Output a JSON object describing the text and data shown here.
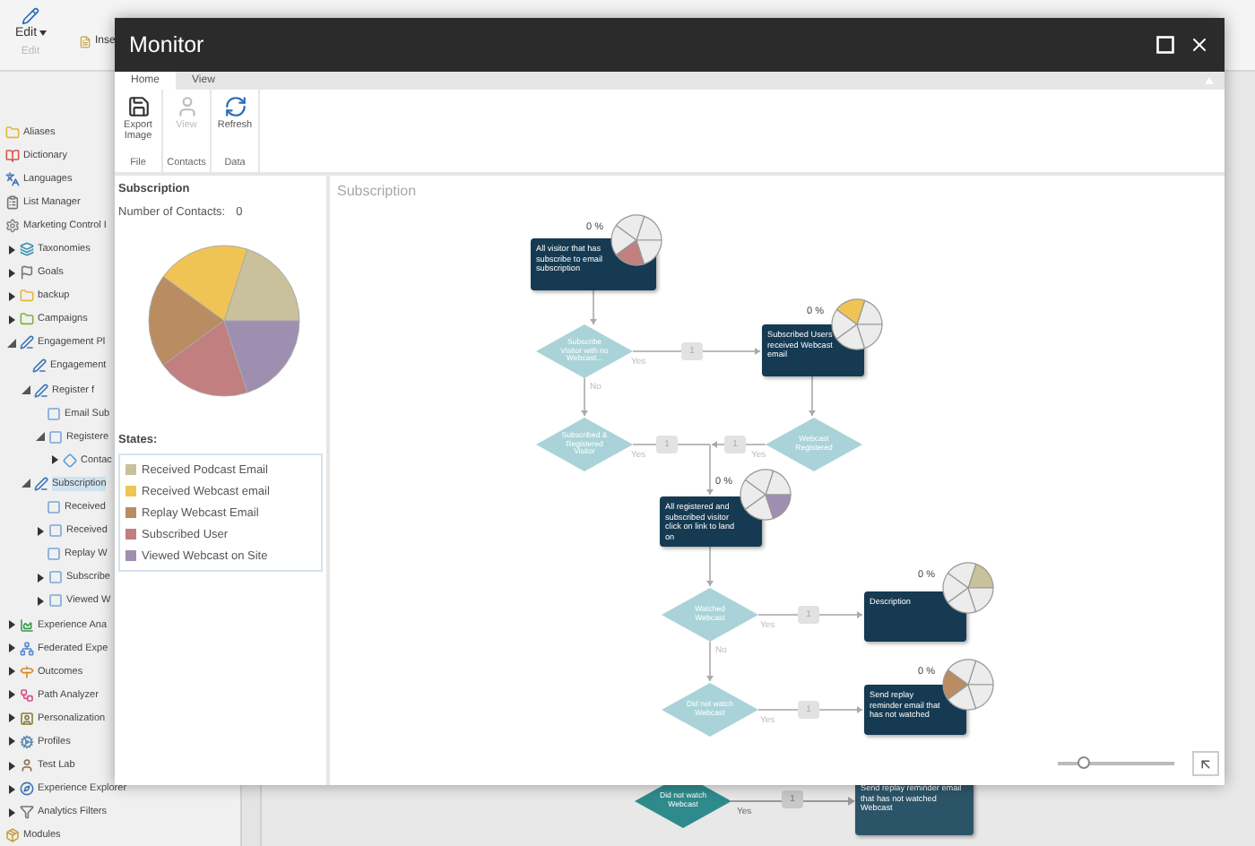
{
  "app_ribbon": {
    "edit_button": "Edit",
    "group_label": "Edit",
    "insert_item": "Inse"
  },
  "tree": [
    {
      "label": "Aliases",
      "selected": false
    },
    {
      "label": "Dictionary",
      "selected": false
    },
    {
      "label": "Languages",
      "selected": false
    },
    {
      "label": "List Manager",
      "selected": false
    },
    {
      "label": "Marketing Control I",
      "selected": false
    },
    {
      "label": "Taxonomies",
      "selected": false,
      "expanded": false
    },
    {
      "label": "Goals",
      "selected": false,
      "expanded": false
    },
    {
      "label": "backup",
      "selected": false,
      "expanded": false
    },
    {
      "label": "Campaigns",
      "selected": false,
      "expanded": false
    },
    {
      "label": "Engagement Pl",
      "selected": false,
      "expanded": true,
      "children": [
        {
          "label": "Engagement",
          "selected": false
        },
        {
          "label": "Register f",
          "selected": false,
          "expanded": true,
          "children": [
            {
              "label": "Email Sub",
              "selected": false
            },
            {
              "label": "Registere",
              "selected": false,
              "expanded": true,
              "children": [
                {
                  "label": "Contac",
                  "selected": false,
                  "expanded": false
                }
              ]
            }
          ]
        },
        {
          "label": "Subscription",
          "selected": true,
          "expanded": true,
          "children": [
            {
              "label": "Received",
              "selected": false
            },
            {
              "label": "Received",
              "selected": false,
              "expanded": false
            },
            {
              "label": "Replay W",
              "selected": false
            },
            {
              "label": "Subscribe",
              "selected": false,
              "expanded": false
            },
            {
              "label": "Viewed W",
              "selected": false,
              "expanded": false
            }
          ]
        }
      ]
    },
    {
      "label": "Experience Ana",
      "selected": false,
      "expanded": false
    },
    {
      "label": "Federated Expe",
      "selected": false,
      "expanded": false
    },
    {
      "label": "Outcomes",
      "selected": false,
      "expanded": false
    },
    {
      "label": "Path Analyzer",
      "selected": false,
      "expanded": false
    },
    {
      "label": "Personalization",
      "selected": false,
      "expanded": false
    },
    {
      "label": "Profiles",
      "selected": false,
      "expanded": false
    },
    {
      "label": "Test Lab",
      "selected": false,
      "expanded": false
    },
    {
      "label": "Experience Explorer",
      "selected": false,
      "expanded": false
    },
    {
      "label": "Analytics Filters",
      "selected": false,
      "expanded": false
    },
    {
      "label": "Modules",
      "selected": false
    }
  ],
  "background_flow": {
    "decision": "Did not watch Webcast",
    "edge_label": "Yes",
    "badge": "1",
    "action": "Send replay reminder email that has not watched Webcast"
  },
  "monitor": {
    "title": "Monitor",
    "tabs": [
      {
        "label": "Home",
        "selected": true
      },
      {
        "label": "View",
        "selected": false
      }
    ],
    "groups": [
      {
        "label": "File",
        "buttons": [
          {
            "label": "Export Image",
            "disabled": false
          }
        ]
      },
      {
        "label": "Contacts",
        "buttons": [
          {
            "label": "View",
            "disabled": true
          }
        ]
      },
      {
        "label": "Data",
        "buttons": [
          {
            "label": "Refresh",
            "disabled": false
          }
        ]
      }
    ],
    "summary": {
      "title": "Subscription",
      "contacts_label": "Number of Contacts:",
      "contacts_value": "0",
      "states_label": "States:"
    },
    "states": [
      {
        "name": "Received Podcast Email",
        "color": "#c8c19b"
      },
      {
        "name": "Received Webcast email",
        "color": "#f0c454"
      },
      {
        "name": "Replay Webcast Email",
        "color": "#b98c62"
      },
      {
        "name": "Subscribed User",
        "color": "#c17f7f"
      },
      {
        "name": "Viewed Webcast on Site",
        "color": "#9e8fb0"
      }
    ],
    "flow": {
      "title": "Subscription",
      "nodes": [
        {
          "kind": "action",
          "text": "All visitor that has subscribe to email subscription",
          "percent": "0 %",
          "color": "#c17f7f"
        },
        {
          "kind": "decision",
          "text": "Subscribe Visitor with no Webcast..."
        },
        {
          "kind": "action",
          "text": "Subscribed Users received Webcast email",
          "percent": "0 %",
          "color": "#f0c454"
        },
        {
          "kind": "decision",
          "text": "Subscribed & Registered Visitor"
        },
        {
          "kind": "decision",
          "text": "Webcast Registered"
        },
        {
          "kind": "action",
          "text": "All registered and subscribed visitor click on link to land on",
          "percent": "0 %",
          "color": "#9e8fb0"
        },
        {
          "kind": "decision",
          "text": "Watched Webcast"
        },
        {
          "kind": "action",
          "text": "Description",
          "percent": "0 %",
          "color": "#c8c19b"
        },
        {
          "kind": "decision",
          "text": "Did not watch Webcast"
        },
        {
          "kind": "action",
          "text": "Send replay reminder email that has not watched",
          "percent": "0 %",
          "color": "#b98c62"
        }
      ],
      "edge_labels": [
        {
          "label": "Yes",
          "badge": "1"
        },
        {
          "label": "No"
        },
        {
          "label": "Yes",
          "badge": "1"
        },
        {
          "label": "Yes",
          "badge": "1"
        },
        {
          "label": "Yes",
          "badge": "1"
        },
        {
          "label": "No"
        },
        {
          "label": "Yes",
          "badge": "1"
        }
      ]
    },
    "zoom": {
      "level": 0.22
    }
  }
}
